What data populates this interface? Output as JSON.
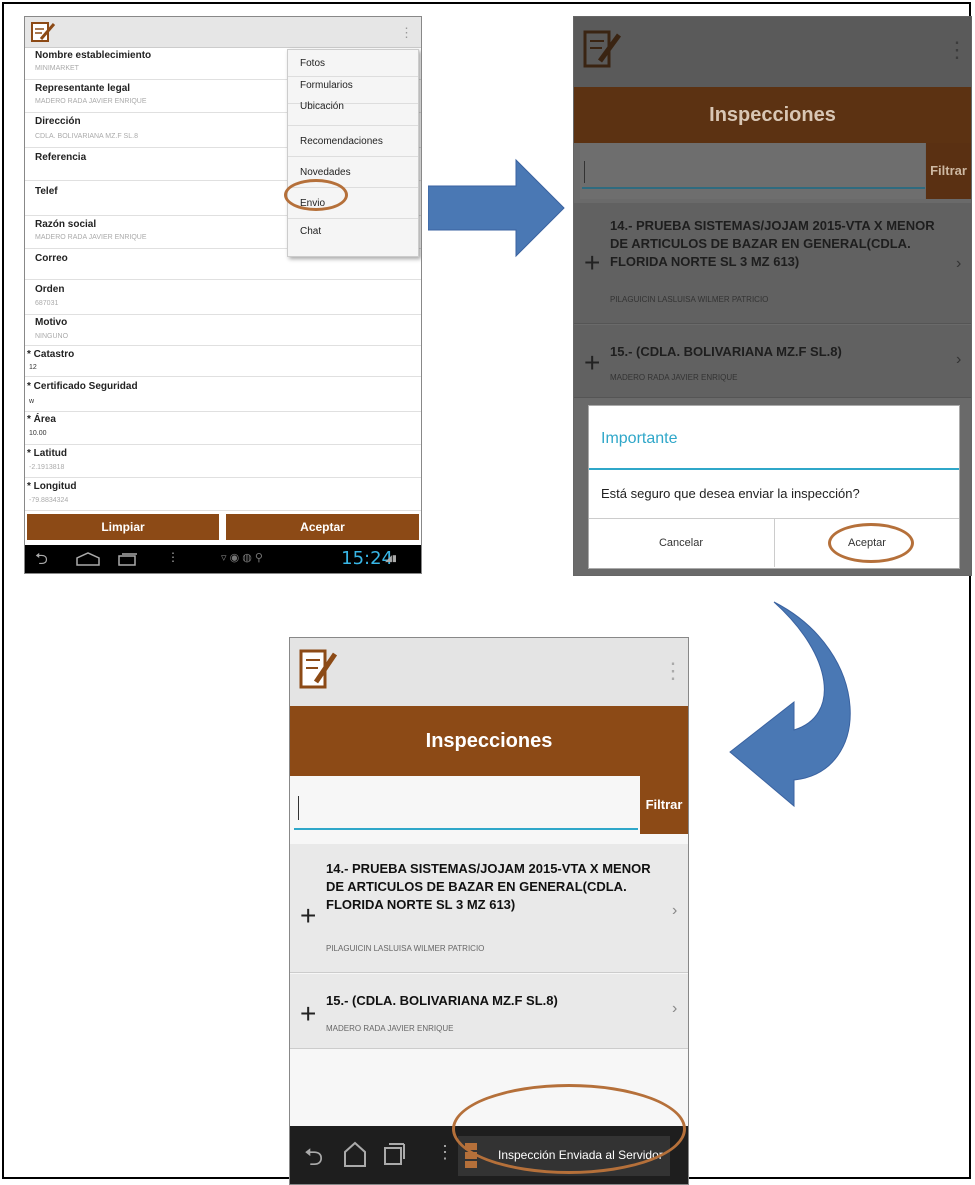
{
  "screen1": {
    "fields": [
      {
        "label": "Nombre establecimiento",
        "value": "MINIMARKET"
      },
      {
        "label": "Representante legal",
        "value": "MADERO RADA JAVIER ENRIQUE"
      },
      {
        "label": "Dirección",
        "value": "CDLA. BOLIVARIANA MZ.F SL.8"
      },
      {
        "label": "Referencia",
        "value": ""
      },
      {
        "label": "Telef",
        "value": ""
      },
      {
        "label": "Razón social",
        "value": "MADERO RADA JAVIER ENRIQUE"
      },
      {
        "label": "Correo",
        "value": ""
      },
      {
        "label": "Orden",
        "value": "687031"
      },
      {
        "label": "Motivo",
        "value": "NINGUNO"
      },
      {
        "label": "* Catastro",
        "value": "12"
      },
      {
        "label": "* Certificado Seguridad",
        "value": "w"
      },
      {
        "label": "* Área",
        "value": "10.00"
      },
      {
        "label": "* Latitud",
        "value": "-2.1913818"
      },
      {
        "label": "* Longitud",
        "value": "-79.8834324"
      }
    ],
    "menu": [
      "Fotos",
      "Formularios",
      "Ubicación",
      "Recomendaciones",
      "Novedades",
      "Envio",
      "Chat"
    ],
    "clear_button": "Limpiar",
    "accept_button": "Aceptar",
    "clock": "15:24"
  },
  "screen2": {
    "title": "Inspecciones",
    "filter_button": "Filtrar",
    "items": [
      {
        "title": "14.- PRUEBA SISTEMAS/JOJAM 2015-VTA X MENOR DE ARTICULOS DE BAZAR EN GENERAL(CDLA. FLORIDA NORTE SL 3 MZ 613)",
        "subtitle": "PILAGUICIN LASLUISA WILMER PATRICIO"
      },
      {
        "title": "15.- (CDLA. BOLIVARIANA MZ.F SL.8)",
        "subtitle": "MADERO RADA JAVIER ENRIQUE"
      }
    ],
    "dialog": {
      "title": "Importante",
      "message": "Está seguro que desea enviar la inspección?",
      "cancel": "Cancelar",
      "accept": "Aceptar"
    }
  },
  "screen3": {
    "title": "Inspecciones",
    "filter_button": "Filtrar",
    "items": [
      {
        "title": "14.- PRUEBA SISTEMAS/JOJAM 2015-VTA X MENOR DE ARTICULOS DE BAZAR EN GENERAL(CDLA. FLORIDA NORTE SL 3 MZ 613)",
        "subtitle": "PILAGUICIN LASLUISA WILMER PATRICIO"
      },
      {
        "title": "15.- (CDLA. BOLIVARIANA MZ.F SL.8)",
        "subtitle": "MADERO RADA JAVIER ENRIQUE"
      }
    ],
    "toast": "Inspección Enviada al Servidor"
  },
  "colors": {
    "accent_brown": "#8c4a16",
    "annotation_oval": "#b5703a",
    "arrow_blue": "#4a78b4",
    "input_underline": "#2fa7c9"
  },
  "icons": [
    "notepad-pencil-icon",
    "overflow-menu-icon",
    "back-icon",
    "home-icon",
    "recents-icon",
    "plus-icon",
    "chevron-right-icon"
  ]
}
